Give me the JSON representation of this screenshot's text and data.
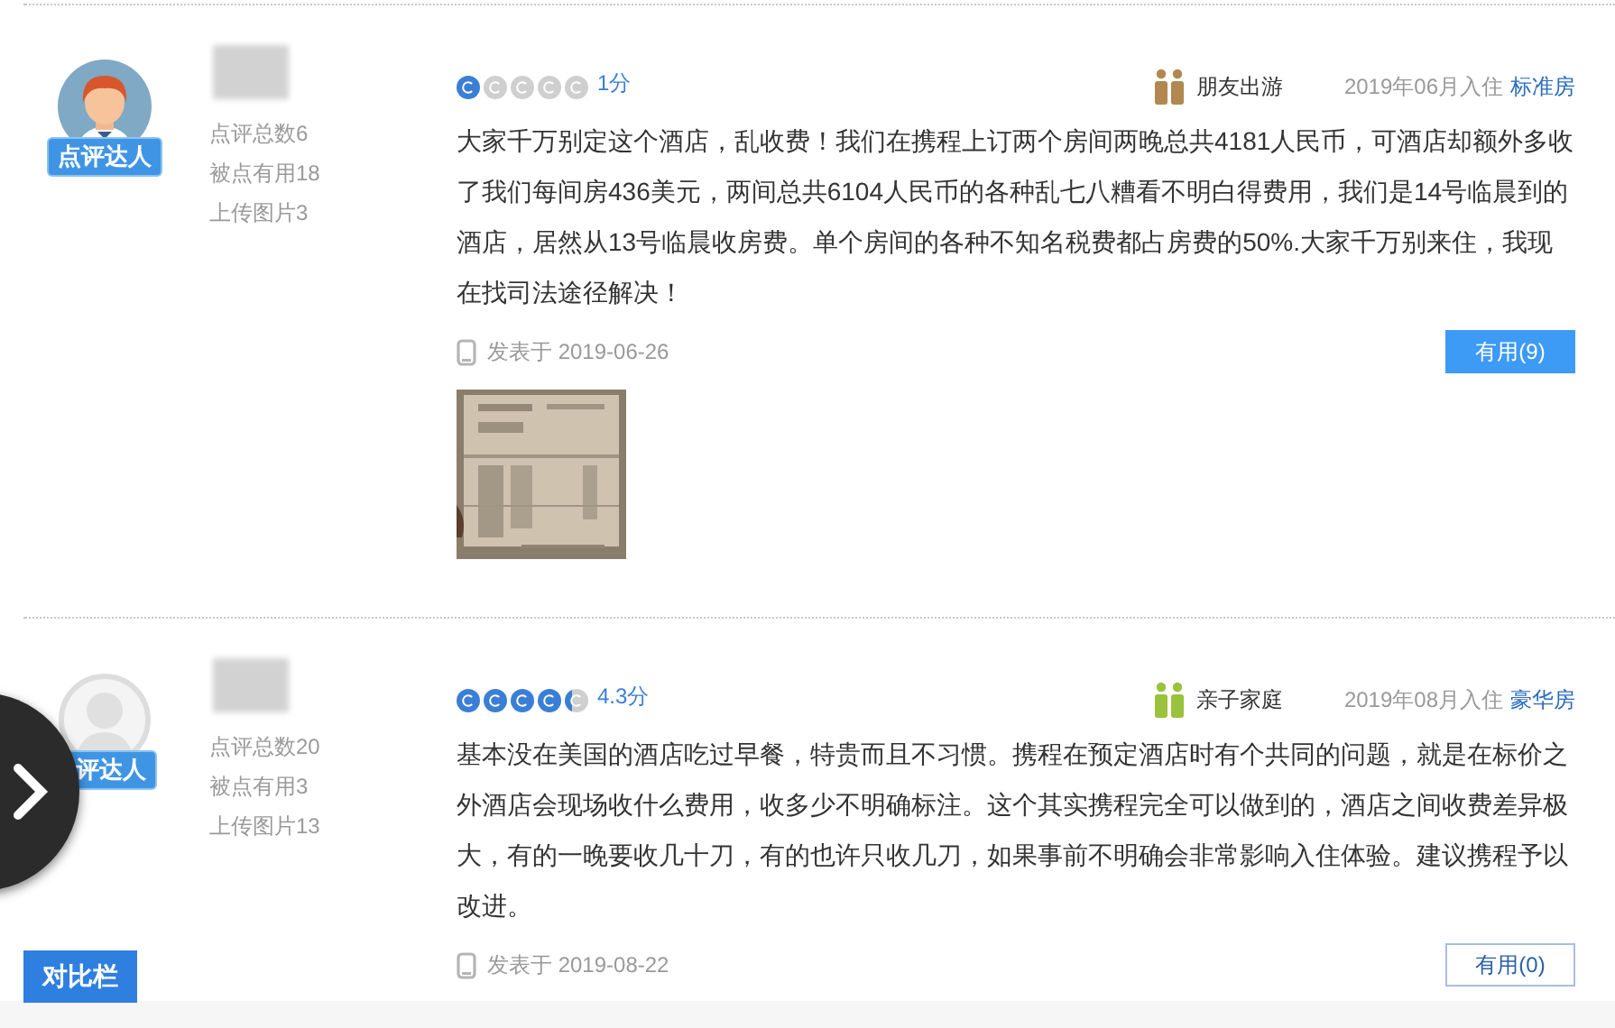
{
  "reviews": [
    {
      "avatar": {
        "kind": "figure",
        "badge": "点评达人"
      },
      "stats": [
        "点评总数6",
        "被点有用18",
        "上传图片3"
      ],
      "rating": {
        "stars": 1,
        "score": "1分"
      },
      "trip": {
        "label": "朋友出游",
        "color": "#b08850"
      },
      "stay": "2019年06月入住",
      "room": "标准房",
      "text": "大家千万别定这个酒店，乱收费！我们在携程上订两个房间两晚总共4181人民币，可酒店却额外多收了我们每间房436美元，两间总共6104人民币的各种乱七八糟看不明白得费用，我们是14号临晨到的酒店，居然从13号临晨收房费。单个房间的各种不知名税费都占房费的50%.大家千万别来住，我现在找司法途径解决！",
      "posted": "发表于 2019-06-26",
      "useful": {
        "label": "有用(9)",
        "selected": true
      }
    },
    {
      "avatar": {
        "kind": "silhouette",
        "badge": "评达人"
      },
      "stats": [
        "点评总数20",
        "被点有用3",
        "上传图片13"
      ],
      "rating": {
        "stars": 4.3,
        "score": "4.3分"
      },
      "trip": {
        "label": "亲子家庭",
        "color": "#9ac23c"
      },
      "stay": "2019年08月入住",
      "room": "豪华房",
      "text": "基本没在美国的酒店吃过早餐，特贵而且不习惯。携程在预定酒店时有个共同的问题，就是在标价之外酒店会现场收什么费用，收多少不明确标注。这个其实携程完全可以做到的，酒店之间收费差异极大，有的一晚要收几十刀，有的也许只收几刀，如果事前不明确会非常影响入住体验。建议携程予以改进。",
      "posted": "发表于 2019-08-22",
      "useful": {
        "label": "有用(0)",
        "selected": false
      }
    }
  ],
  "compare_button": {
    "label": "对比栏"
  }
}
